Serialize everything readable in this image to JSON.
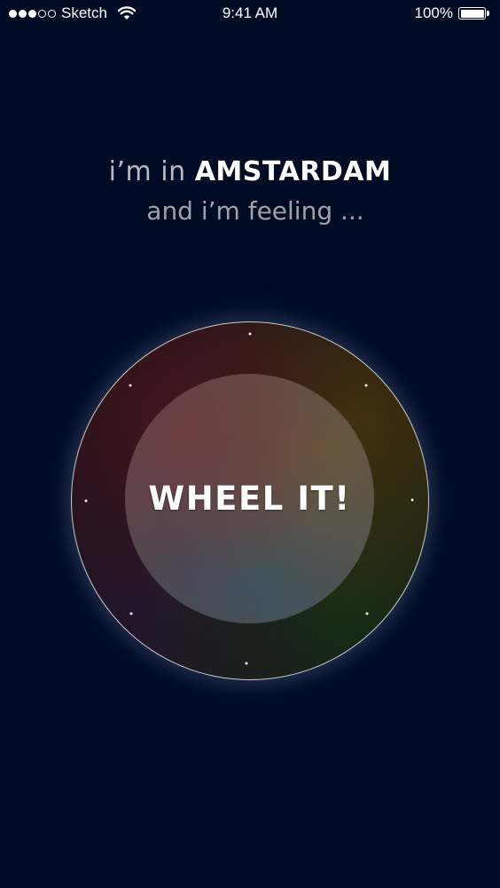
{
  "status_bar": {
    "carrier": "Sketch",
    "signal_bars_filled": 3,
    "signal_bars_total": 5,
    "time": "9:41 AM",
    "battery_percent": "100%",
    "icons": [
      "signal-dots",
      "wifi-icon",
      "battery-icon"
    ]
  },
  "headline": {
    "prefix": "i’m in",
    "city": "AMSTARDAM",
    "line2": "and i’m feeling  ..."
  },
  "wheel": {
    "button_label": "WHEEL IT!",
    "tick_count": 8
  },
  "colors": {
    "background": "#000b24",
    "text_primary": "#ffffff",
    "text_secondary": "#a0a2aa",
    "ring": "#ebebe1"
  }
}
